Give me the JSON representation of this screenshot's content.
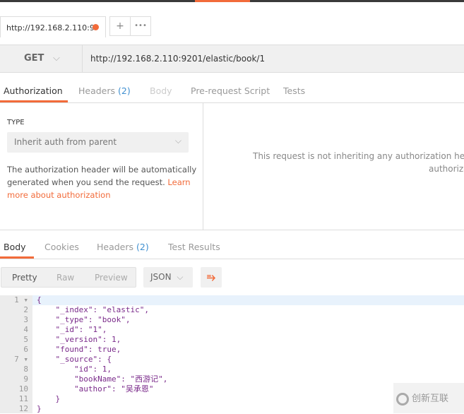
{
  "tab": {
    "title": "http://192.168.2.110:9",
    "unsaved_color": "#f26b3a",
    "new_tab": "+",
    "more": "•••"
  },
  "request": {
    "method": "GET",
    "url": "http://192.168.2.110:9201/elastic/book/1"
  },
  "request_tabs": [
    {
      "label": "Authorization"
    },
    {
      "label": "Headers",
      "count": "(2)"
    },
    {
      "label": "Body"
    },
    {
      "label": "Pre-request Script"
    },
    {
      "label": "Tests"
    }
  ],
  "auth": {
    "type_label": "TYPE",
    "type_value": "Inherit auth from parent",
    "desc": "The authorization header will be automatically generated when you send the request.",
    "learn_more": "Learn more about authorization",
    "right_line1": "This request is not inheriting any authorization helper",
    "right_line2": "authoriza"
  },
  "response_tabs": [
    {
      "label": "Body"
    },
    {
      "label": "Cookies"
    },
    {
      "label": "Headers",
      "count": "(2)"
    },
    {
      "label": "Test Results"
    }
  ],
  "view_modes": [
    "Pretty",
    "Raw",
    "Preview"
  ],
  "format": "JSON",
  "code_lines": [
    "{",
    "    \"_index\": \"elastic\",",
    "    \"_type\": \"book\",",
    "    \"_id\": \"1\",",
    "    \"_version\": 1,",
    "    \"found\": true,",
    "    \"_source\": {",
    "        \"id\": 1,",
    "        \"bookName\": \"西游记\",",
    "        \"author\": \"吴承恩\"",
    "    }",
    "}"
  ],
  "line_numbers": [
    "1",
    "2",
    "3",
    "4",
    "5",
    "6",
    "7",
    "8",
    "9",
    "10",
    "11",
    "12"
  ],
  "watermark": "创新互联",
  "colors": {
    "accent": "#f26b3a",
    "link": "#f26b3a",
    "count": "#3f8fd0"
  }
}
